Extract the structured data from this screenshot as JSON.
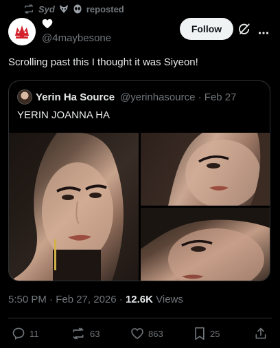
{
  "repost_banner": {
    "user": "Syd",
    "label": "reposted"
  },
  "post": {
    "author_handle": "@4maybesone",
    "follow_label": "Follow",
    "text": "Scrolling past this I thought it was Siyeon!",
    "timestamp": "5:50 PM · Feb 27, 2026 · ",
    "views_count": "12.6K",
    "views_label": " Views"
  },
  "quote": {
    "author_name": "Yerin Ha Source",
    "author_meta": "@yerinhasource · Feb 27",
    "text": "YERIN JOANNA HA"
  },
  "actions": {
    "replies": "11",
    "reposts": "63",
    "likes": "863",
    "bookmarks": "25"
  },
  "icons": {
    "repost": "repost-icon",
    "heart": "heart-icon",
    "grok": "grok-icon",
    "more": "more-icon",
    "reply": "reply-icon",
    "like": "like-icon",
    "bookmark": "bookmark-icon",
    "share": "share-icon"
  },
  "colors": {
    "background": "#000000",
    "text_primary": "#e7e9ea",
    "text_secondary": "#71767b",
    "border": "#2f3336",
    "follow_button": "#eff3f4",
    "avatar_red": "#d3212d"
  }
}
